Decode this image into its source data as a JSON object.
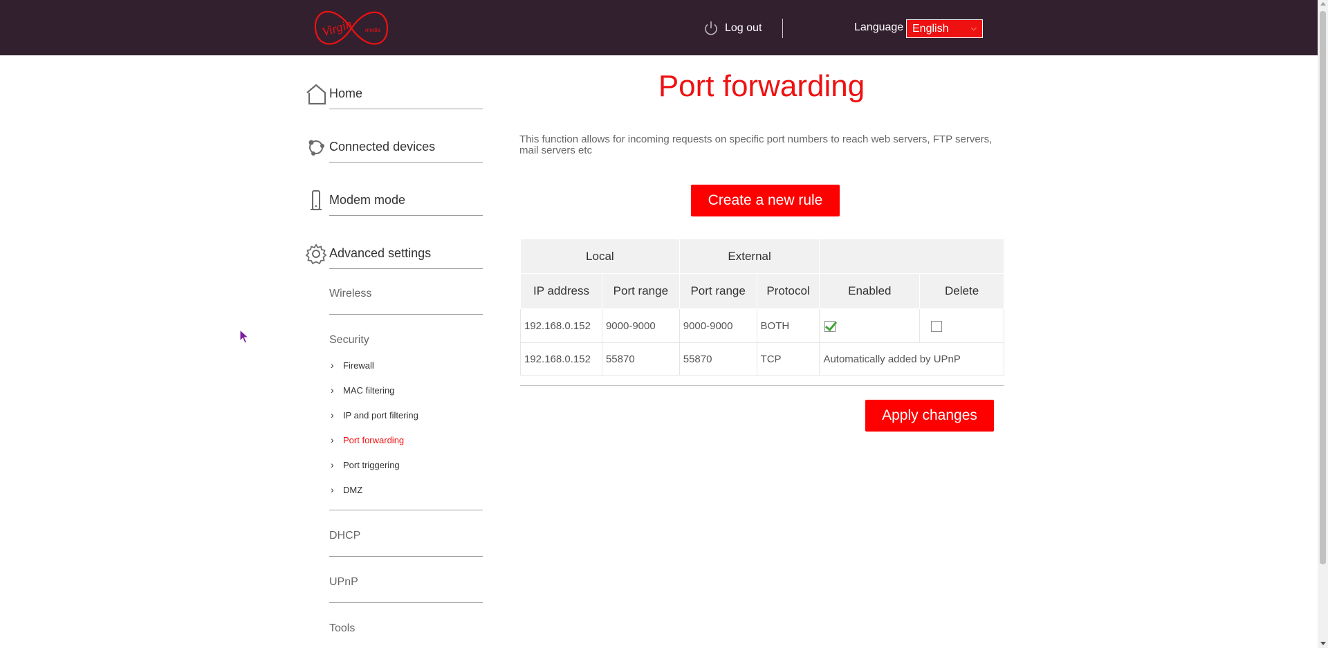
{
  "header": {
    "logo_text": "Virgin media",
    "logout_label": "Log out",
    "language_label": "Language",
    "language_selected": "English",
    "icons": {
      "logout": "power-icon",
      "dropdown": "chevron-down-icon"
    }
  },
  "sidebar": {
    "main_items": [
      {
        "label": "Home",
        "icon": "home-icon"
      },
      {
        "label": "Connected devices",
        "icon": "devices-icon"
      },
      {
        "label": "Modem mode",
        "icon": "modem-icon"
      },
      {
        "label": "Advanced settings",
        "icon": "gear-icon"
      }
    ],
    "sub_items": {
      "wireless": "Wireless",
      "security": "Security",
      "security_children": [
        "Firewall",
        "MAC filtering",
        "IP and port filtering",
        "Port forwarding",
        "Port triggering",
        "DMZ"
      ],
      "active_child": "Port forwarding",
      "dhcp": "DHCP",
      "upnp": "UPnP",
      "tools": "Tools"
    }
  },
  "main": {
    "title": "Port forwarding",
    "description": "This function allows for incoming requests on specific port numbers to reach web servers, FTP servers, mail servers etc",
    "create_button": "Create a new rule",
    "apply_button": "Apply changes",
    "table": {
      "group_headers": {
        "local": "Local",
        "external": "External"
      },
      "columns": [
        "IP address",
        "Port range",
        "Port range",
        "Protocol",
        "Enabled",
        "Delete"
      ],
      "rows": [
        {
          "ip": "192.168.0.152",
          "local_port": "9000-9000",
          "external_port": "9000-9000",
          "protocol": "BOTH",
          "enabled": true,
          "delete": false
        },
        {
          "ip": "192.168.0.152",
          "local_port": "55870",
          "external_port": "55870",
          "protocol": "TCP",
          "note": "Automatically added by UPnP"
        }
      ]
    }
  },
  "colors": {
    "header_bg": "#33202f",
    "accent_red": "#ee1111",
    "button_red": "#ff0000",
    "check_green": "#3da635",
    "table_header_bg": "#f1f1f1"
  }
}
